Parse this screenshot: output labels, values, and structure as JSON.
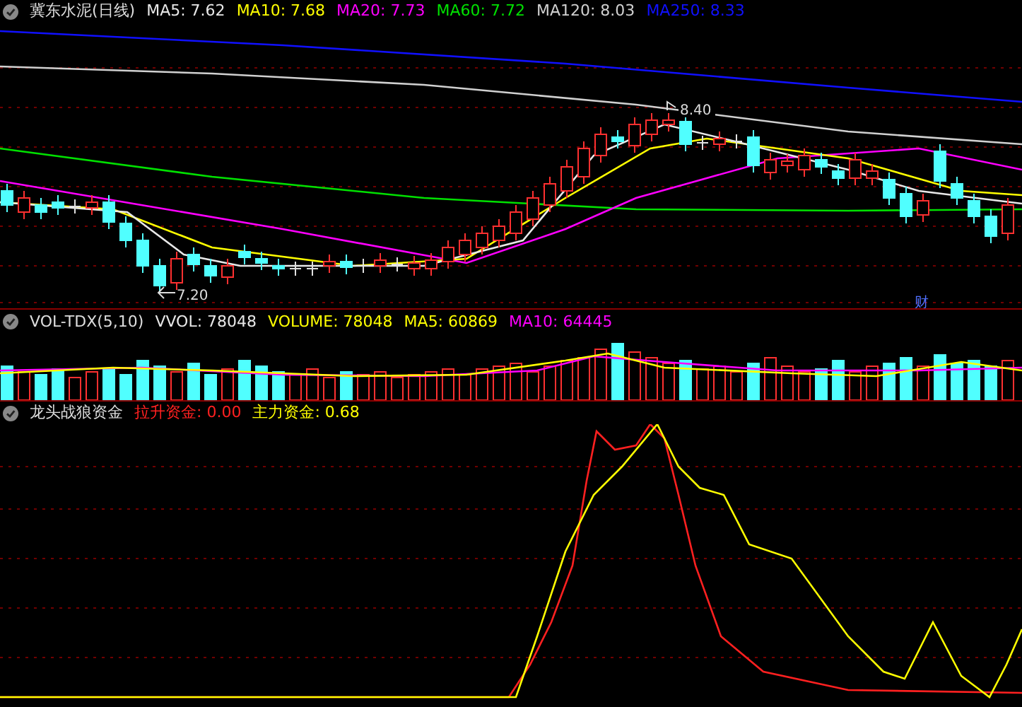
{
  "price_panel": {
    "title": "冀东水泥(日线)",
    "indicators": [
      {
        "label": "MA5: 7.62",
        "color": "#e8e8e8"
      },
      {
        "label": "MA10: 7.68",
        "color": "#ffff00"
      },
      {
        "label": "MA20: 7.73",
        "color": "#ff00ff"
      },
      {
        "label": "MA60: 7.72",
        "color": "#00e000"
      },
      {
        "label": "MA120: 8.03",
        "color": "#d0d0d0"
      },
      {
        "label": "MA250: 8.33",
        "color": "#1010ff"
      }
    ],
    "high_marker": "8.40",
    "low_marker": "7.20",
    "event_marker": "财"
  },
  "volume_panel": {
    "title": "VOL-TDX(5,10)",
    "indicators": [
      {
        "label": "VVOL: 78048",
        "color": "#e8e8e8"
      },
      {
        "label": "VOLUME: 78048",
        "color": "#ffff00"
      },
      {
        "label": "MA5: 60869",
        "color": "#ffff00"
      },
      {
        "label": "MA10: 64445",
        "color": "#ff00ff"
      }
    ]
  },
  "indicator_panel": {
    "title": "龙头战狼资金",
    "indicators": [
      {
        "label": "拉升资金: 0.00",
        "color": "#ff2020"
      },
      {
        "label": "主力资金: 0.68",
        "color": "#ffff00"
      }
    ]
  }
}
